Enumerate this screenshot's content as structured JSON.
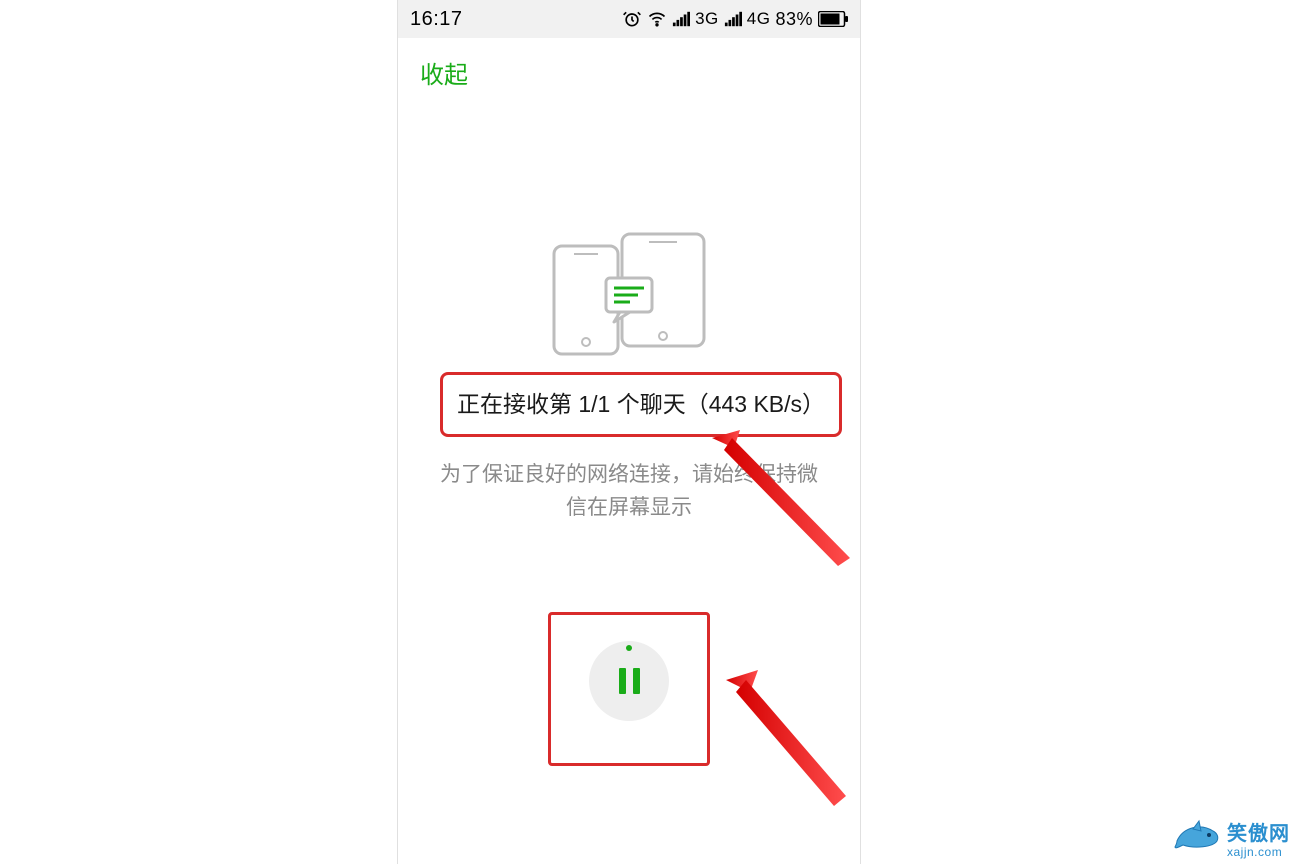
{
  "status_bar": {
    "time": "16:17",
    "sim1": "3G",
    "sim2": "4G",
    "battery": "83%"
  },
  "nav": {
    "collapse": "收起"
  },
  "transfer": {
    "status": "正在接收第 1/1 个聊天（443 KB/s）",
    "hint": "为了保证良好的网络连接，请始终保持微信在屏幕显示"
  },
  "icons": {
    "alarm": "alarm-icon",
    "wifi": "wifi-icon",
    "signal1": "signal-icon",
    "signal2": "signal-icon",
    "battery": "battery-icon",
    "phones": "two-phones-transfer-icon",
    "pause": "pause-icon"
  },
  "watermark": {
    "name": "笑傲网",
    "url": "xajjn.com"
  },
  "colors": {
    "accent": "#1aac19",
    "highlight": "#d92b2b",
    "brand": "#2b8fcf"
  }
}
